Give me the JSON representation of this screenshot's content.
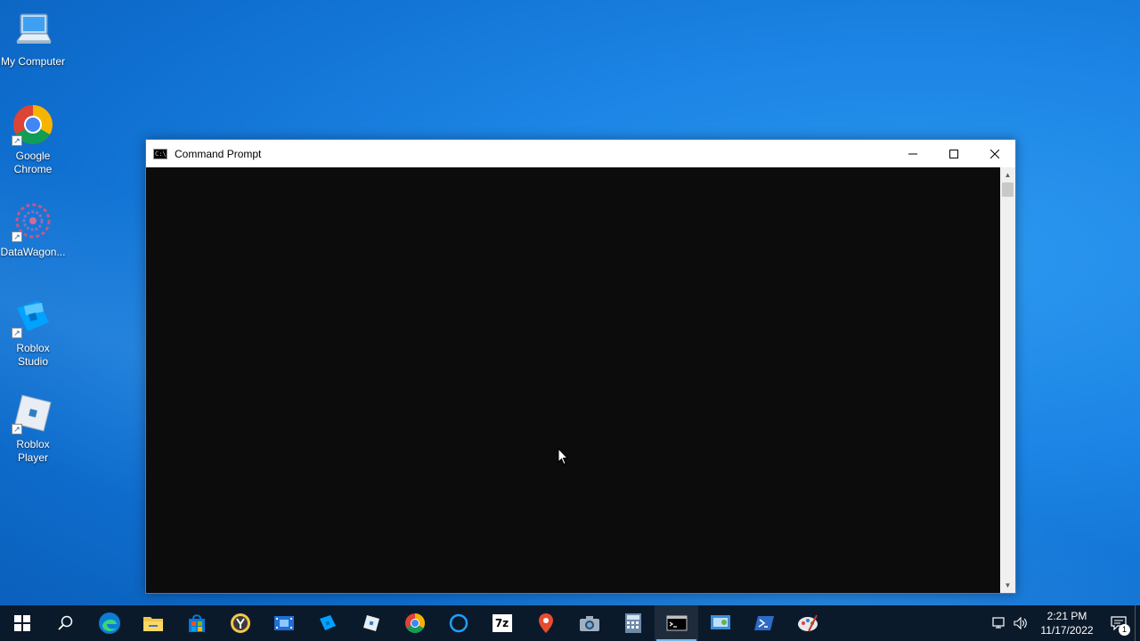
{
  "desktop": {
    "icons": [
      {
        "label": "My Computer"
      },
      {
        "label": "Google Chrome"
      },
      {
        "label": "DataWagon..."
      },
      {
        "label": "Roblox Studio"
      },
      {
        "label": "Roblox Player"
      }
    ]
  },
  "window": {
    "title": "Command Prompt",
    "icon": "cmd-icon",
    "title_icon_text": "C:\\",
    "controls": [
      "minimize-icon",
      "maximize-icon",
      "close-icon"
    ]
  },
  "taskbar": {
    "apps": [
      {
        "name": "start-button",
        "icon": "windows-logo-icon"
      },
      {
        "name": "search-button",
        "icon": "search-icon"
      },
      {
        "name": "edge",
        "icon": "edge-icon"
      },
      {
        "name": "file-explorer",
        "icon": "folder-icon"
      },
      {
        "name": "store",
        "icon": "store-icon"
      },
      {
        "name": "yandex",
        "icon": "yandex-icon"
      },
      {
        "name": "video-editor",
        "icon": "film-icon"
      },
      {
        "name": "roblox-studio",
        "icon": "roblox-studio-icon"
      },
      {
        "name": "roblox-player",
        "icon": "roblox-player-icon"
      },
      {
        "name": "chrome",
        "icon": "chrome-icon"
      },
      {
        "name": "cortana",
        "icon": "cortana-icon"
      },
      {
        "name": "7zip",
        "icon": "7zip-icon"
      },
      {
        "name": "maps",
        "icon": "maps-pin-icon"
      },
      {
        "name": "camera",
        "icon": "camera-icon"
      },
      {
        "name": "calculator",
        "icon": "calculator-icon"
      },
      {
        "name": "command-prompt",
        "icon": "cmd-icon",
        "active": true
      },
      {
        "name": "control-panel",
        "icon": "control-panel-icon"
      },
      {
        "name": "powershell",
        "icon": "powershell-icon"
      },
      {
        "name": "paint",
        "icon": "paint-icon"
      }
    ],
    "sevenzip_label": "7z",
    "clock_time": "2:21 PM",
    "clock_date": "11/17/2022",
    "notification_count": "1"
  },
  "colors": {
    "console_bg": "#0c0c0c",
    "taskbar_bg": "#0b1a2b",
    "accent": "#76b9ed"
  }
}
